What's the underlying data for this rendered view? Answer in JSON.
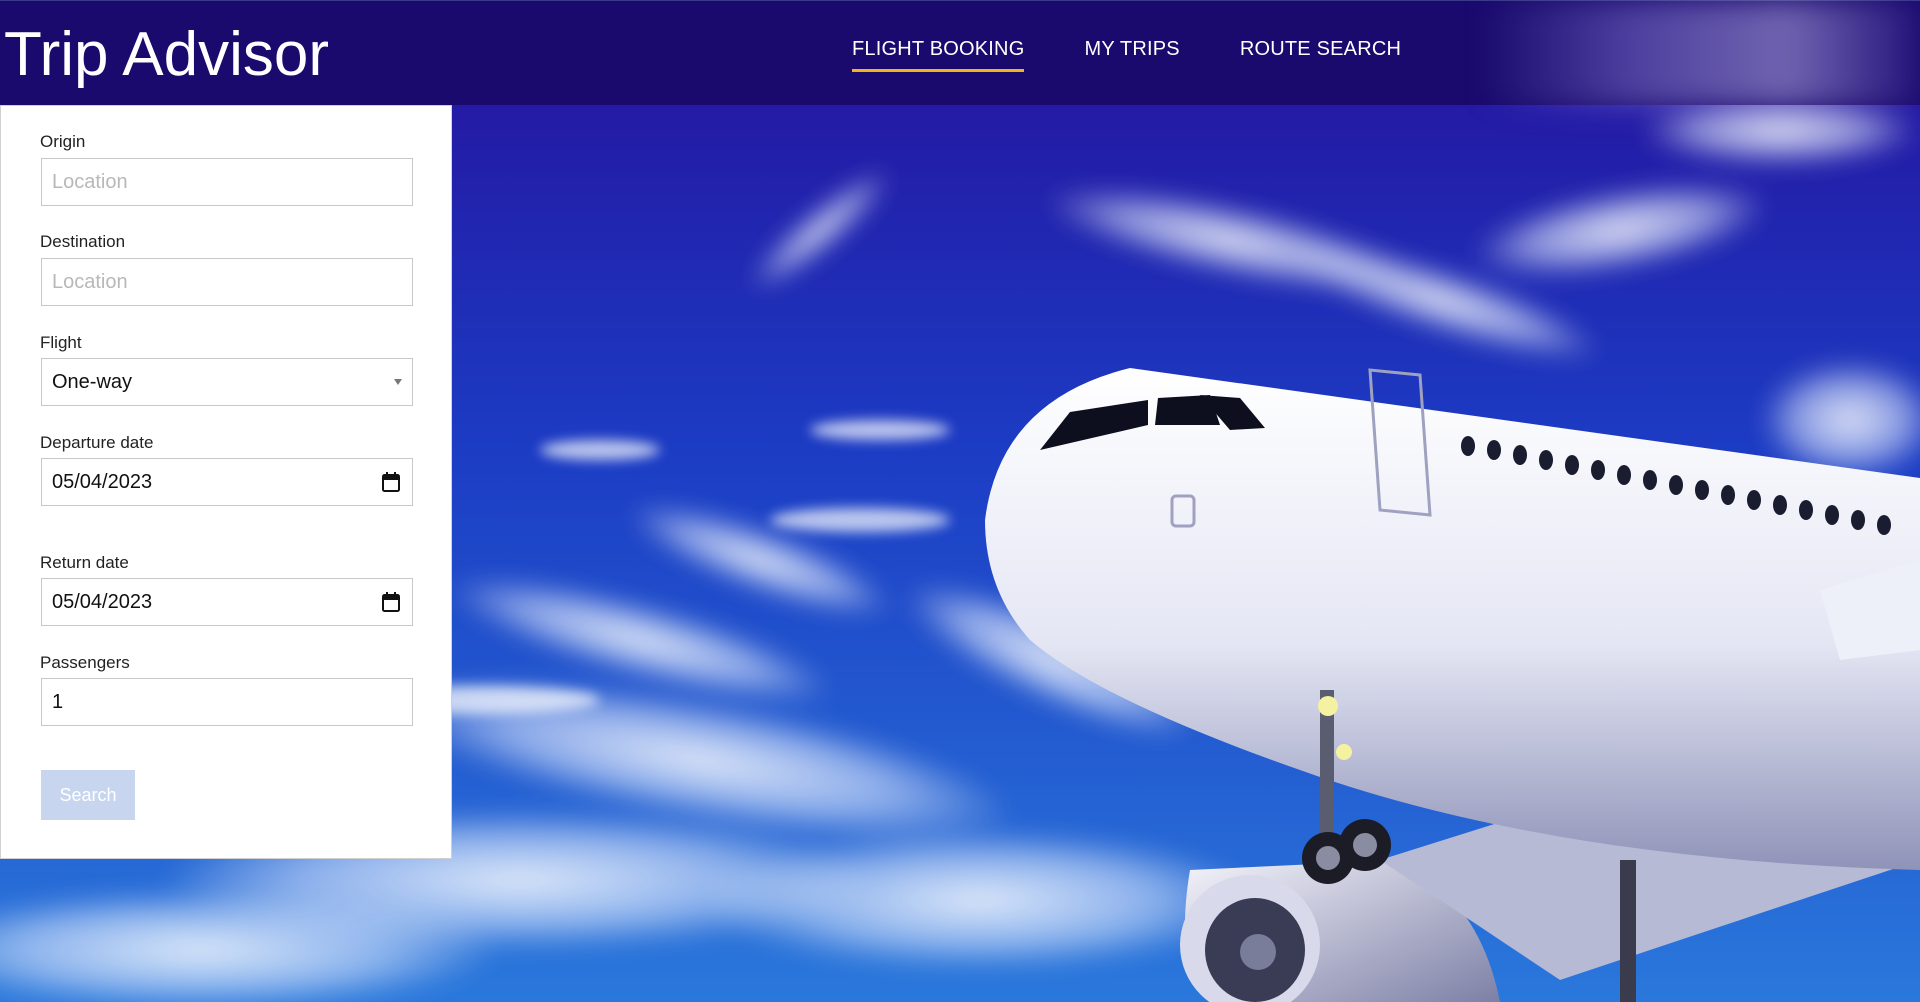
{
  "header": {
    "brand": "Trip Advisor",
    "nav": [
      {
        "label": "FLIGHT BOOKING",
        "active": true
      },
      {
        "label": "MY TRIPS",
        "active": false
      },
      {
        "label": "ROUTE SEARCH",
        "active": false
      }
    ],
    "active_underline_color": "#f2b418"
  },
  "form": {
    "origin": {
      "label": "Origin",
      "placeholder": "Location",
      "value": ""
    },
    "destination": {
      "label": "Destination",
      "placeholder": "Location",
      "value": ""
    },
    "flight": {
      "label": "Flight",
      "value": "One-way"
    },
    "departure_date": {
      "label": "Departure date",
      "value": "05/04/2023"
    },
    "return_date": {
      "label": "Return date",
      "value": "05/04/2023"
    },
    "passengers": {
      "label": "Passengers",
      "value": "1"
    },
    "search_label": "Search"
  },
  "icons": {
    "calendar": "calendar-icon",
    "dropdown": "chevron-down-icon"
  },
  "colors": {
    "header_bg": "#1a0a6e",
    "sky": "#2a14a0",
    "search_button_disabled": "#c7d6ee"
  }
}
